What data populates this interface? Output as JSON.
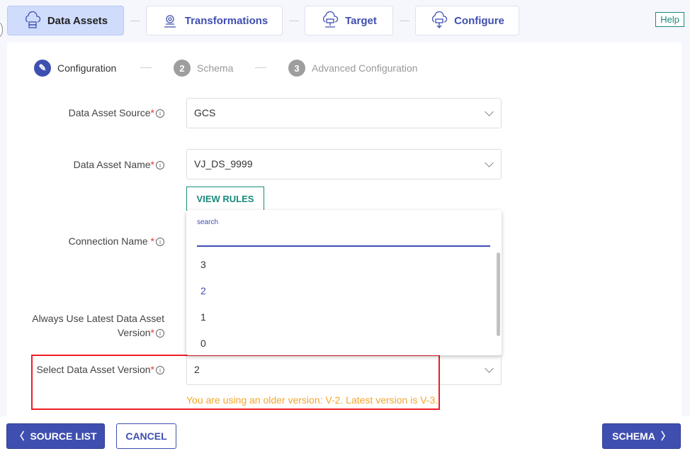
{
  "pipeline": {
    "tabs": [
      {
        "label": "Data Assets",
        "icon": "cloud-data-icon",
        "active": true
      },
      {
        "label": "Transformations",
        "icon": "transform-gear-icon"
      },
      {
        "label": "Target",
        "icon": "cloud-target-icon"
      },
      {
        "label": "Configure",
        "icon": "cloud-configure-icon"
      }
    ],
    "help": "Help"
  },
  "stepper": {
    "steps": [
      {
        "num": "",
        "label": "Configuration",
        "icon": "pencil-icon",
        "active": true
      },
      {
        "num": "2",
        "label": "Schema"
      },
      {
        "num": "3",
        "label": "Advanced Configuration"
      }
    ]
  },
  "form": {
    "source": {
      "label": "Data Asset Source",
      "req": "*",
      "info": "i",
      "value": "GCS"
    },
    "name": {
      "label": "Data Asset Name",
      "req": "*",
      "info": "i",
      "value": "VJ_DS_9999"
    },
    "view_rules": "VIEW RULES",
    "connection": {
      "label": "Connection Name ",
      "req": "*",
      "info": "i"
    },
    "latest": {
      "label1": "Always Use Latest Data Asset",
      "label2": "Version",
      "req": "*",
      "info": "i"
    },
    "version": {
      "label": "Select Data Asset Version",
      "req": "*",
      "info": "i",
      "value": "2",
      "warning": "You are using an older version: V-2. Latest version is V-3."
    }
  },
  "dropdown": {
    "search_label": "search",
    "search_value": "",
    "options": [
      "3",
      "2",
      "1",
      "0"
    ],
    "selected": "2"
  },
  "footer": {
    "source_list": "SOURCE LIST",
    "cancel": "CANCEL",
    "schema": "SCHEMA"
  },
  "colors": {
    "primary": "#3f4fb0",
    "teal": "#1a8a7a",
    "warning": "#f4a62a",
    "highlight": "#ee1c25"
  }
}
